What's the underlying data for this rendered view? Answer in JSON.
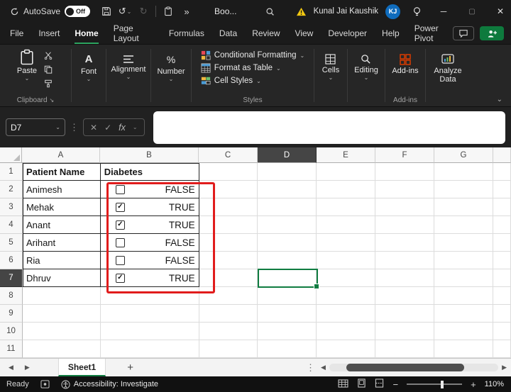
{
  "titlebar": {
    "autosave_label": "AutoSave",
    "autosave_state": "Off",
    "workbook_name": "Boo...",
    "user_name": "Kunal Jai Kaushik",
    "user_initials": "KJ"
  },
  "menubar": {
    "items": [
      "File",
      "Insert",
      "Home",
      "Page Layout",
      "Formulas",
      "Data",
      "Review",
      "View",
      "Developer",
      "Help",
      "Power Pivot"
    ],
    "active_index": 2
  },
  "ribbon": {
    "paste_label": "Paste",
    "clipboard_group_label": "Clipboard",
    "font_label": "Font",
    "alignment_label": "Alignment",
    "number_label": "Number",
    "styles_buttons": [
      "Conditional Formatting",
      "Format as Table",
      "Cell Styles"
    ],
    "styles_group_label": "Styles",
    "cells_label": "Cells",
    "editing_label": "Editing",
    "addins_button_label": "Add-ins",
    "addins_group_label": "Add-ins",
    "analyze_data_label": "Analyze Data"
  },
  "formula_bar": {
    "name_box": "D7",
    "fx_label": "fx",
    "value": ""
  },
  "sheet": {
    "column_headers": [
      "A",
      "B",
      "C",
      "D",
      "E",
      "F",
      "G"
    ],
    "row_count": 11,
    "selected_cell": {
      "ref": "D7",
      "column": "D",
      "row": 7
    },
    "table": {
      "columns": [
        "Patient Name",
        "Diabetes"
      ],
      "rows": [
        {
          "patient": "Animesh",
          "diabetes_checked": false,
          "diabetes_text": "FALSE"
        },
        {
          "patient": "Mehak",
          "diabetes_checked": true,
          "diabetes_text": "TRUE"
        },
        {
          "patient": "Anant",
          "diabetes_checked": true,
          "diabetes_text": "TRUE"
        },
        {
          "patient": "Arihant",
          "diabetes_checked": false,
          "diabetes_text": "FALSE"
        },
        {
          "patient": "Ria",
          "diabetes_checked": false,
          "diabetes_text": "FALSE"
        },
        {
          "patient": "Dhruv",
          "diabetes_checked": true,
          "diabetes_text": "TRUE"
        }
      ]
    }
  },
  "tabbar": {
    "active_tab": "Sheet1"
  },
  "statusbar": {
    "mode": "Ready",
    "accessibility_text": "Accessibility: Investigate",
    "zoom_level": "110%"
  },
  "colors": {
    "accent_green": "#107c41",
    "annotation_red": "#e11c1c",
    "avatar_blue": "#0f6cbd",
    "warning_yellow": "#f2c811",
    "addins_red": "#d83b01",
    "dark_chrome": "#1b1b1b"
  }
}
